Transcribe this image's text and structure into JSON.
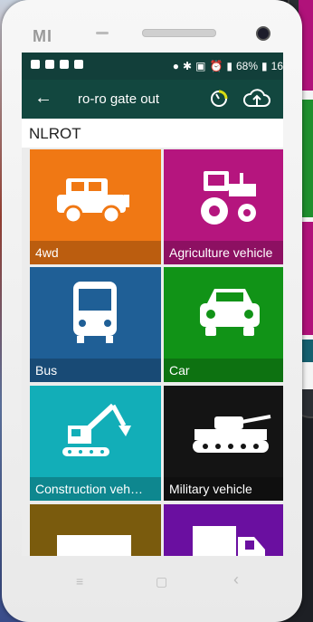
{
  "device": {
    "brand": "MI"
  },
  "status_bar": {
    "battery": "68%",
    "time": "16"
  },
  "app_bar": {
    "back_icon": "arrow-left-icon",
    "title": "ro-ro gate out",
    "gauge_icon": "gauge-icon",
    "upload_icon": "cloud-upload-icon"
  },
  "subheader": {
    "code": "NLROT"
  },
  "tiles": [
    {
      "label": "4wd",
      "color": "#f07814",
      "icon": "suv-icon"
    },
    {
      "label": "Agriculture vehicle",
      "color": "#b5157e",
      "icon": "tractor-icon"
    },
    {
      "label": "Bus",
      "color": "#1f5f96",
      "icon": "bus-icon"
    },
    {
      "label": "Car",
      "color": "#119317",
      "icon": "car-icon"
    },
    {
      "label": "Construction veh…",
      "color": "#12aeb8",
      "icon": "excavator-icon"
    },
    {
      "label": "Military vehicle",
      "color": "#141414",
      "icon": "tank-icon"
    },
    {
      "label": "",
      "color": "#7a5b0d",
      "icon": "trailer-icon"
    },
    {
      "label": "",
      "color": "#6a0fa0",
      "icon": "truck-icon"
    }
  ],
  "nav_bar": {
    "menu": "≡",
    "home": "▢",
    "back": "‹"
  },
  "colors": {
    "status_bar": "#123f3a",
    "app_bar": "#12473f",
    "gauge_accent": "#d7dd12"
  }
}
